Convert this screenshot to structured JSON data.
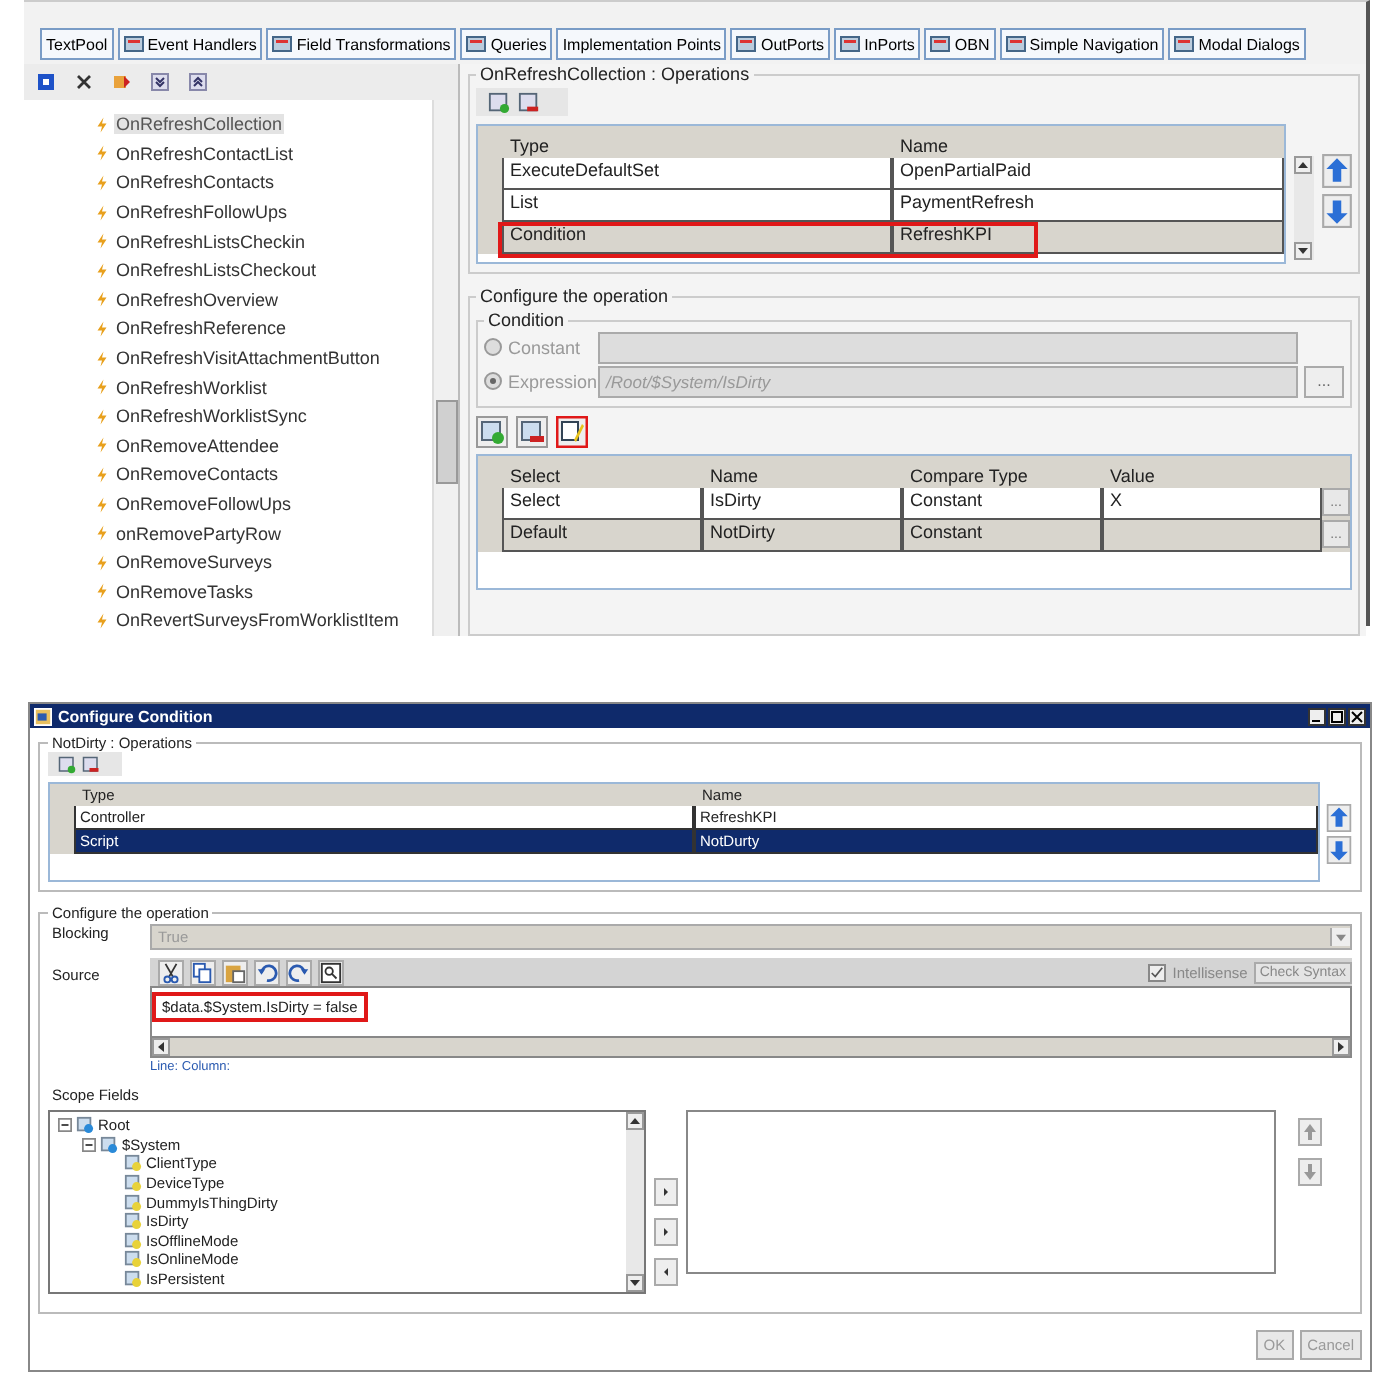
{
  "tabs": [
    {
      "label": "TextPool",
      "has_icon": false
    },
    {
      "label": "Event Handlers",
      "has_icon": true
    },
    {
      "label": "Field Transformations",
      "has_icon": true
    },
    {
      "label": "Queries",
      "has_icon": true
    },
    {
      "label": "Implementation Points",
      "has_icon": false
    },
    {
      "label": "OutPorts",
      "has_icon": true
    },
    {
      "label": "InPorts",
      "has_icon": true
    },
    {
      "label": "OBN",
      "has_icon": true
    },
    {
      "label": "Simple Navigation",
      "has_icon": true
    },
    {
      "label": "Modal Dialogs",
      "has_icon": true
    }
  ],
  "events": [
    {
      "label": "OnRefreshCollection",
      "selected": true
    },
    {
      "label": "OnRefreshContactList",
      "selected": false
    },
    {
      "label": "OnRefreshContacts",
      "selected": false
    },
    {
      "label": "OnRefreshFollowUps",
      "selected": false
    },
    {
      "label": "OnRefreshListsCheckin",
      "selected": false
    },
    {
      "label": "OnRefreshListsCheckout",
      "selected": false
    },
    {
      "label": "OnRefreshOverview",
      "selected": false
    },
    {
      "label": "OnRefreshReference",
      "selected": false
    },
    {
      "label": "OnRefreshVisitAttachmentButton",
      "selected": false
    },
    {
      "label": "OnRefreshWorklist",
      "selected": false
    },
    {
      "label": "OnRefreshWorklistSync",
      "selected": false
    },
    {
      "label": "OnRemoveAttendee",
      "selected": false
    },
    {
      "label": "OnRemoveContacts",
      "selected": false
    },
    {
      "label": "OnRemoveFollowUps",
      "selected": false
    },
    {
      "label": "onRemovePartyRow",
      "selected": false
    },
    {
      "label": "OnRemoveSurveys",
      "selected": false
    },
    {
      "label": "OnRemoveTasks",
      "selected": false
    },
    {
      "label": "OnRevertSurveysFromWorklistItem",
      "selected": false
    }
  ],
  "operations": {
    "title": "OnRefreshCollection : Operations",
    "columns": [
      "Type",
      "Name"
    ],
    "rows": [
      {
        "cells": [
          "ExecuteDefaultSet",
          "OpenPartialPaid"
        ],
        "selected": false,
        "highlighted": false
      },
      {
        "cells": [
          "List",
          "PaymentRefresh"
        ],
        "selected": false,
        "highlighted": false
      },
      {
        "cells": [
          "Condition",
          "RefreshKPI"
        ],
        "selected": true,
        "highlighted": true
      }
    ]
  },
  "configure": {
    "title": "Configure the operation",
    "condition_title": "Condition",
    "options": [
      {
        "label": "Constant",
        "selected": false
      },
      {
        "label": "Expression",
        "selected": true,
        "value": "/Root/$System/IsDirty"
      }
    ],
    "browse": "...",
    "edit_highlighted": true
  },
  "conditions": {
    "columns": [
      "Select",
      "Name",
      "Compare Type",
      "Value"
    ],
    "rows": [
      {
        "cells": [
          "Select",
          "IsDirty",
          "Constant",
          "X"
        ],
        "selected": false,
        "button": "..."
      },
      {
        "cells": [
          "Default",
          "NotDirty",
          "Constant",
          ""
        ],
        "selected": true,
        "button": "..."
      }
    ]
  },
  "dialog": {
    "title": "Configure Condition",
    "operations_title": "NotDirty : Operations",
    "columns": [
      "Type",
      "Name"
    ],
    "rows": [
      {
        "cells": [
          "Controller",
          "RefreshKPI"
        ],
        "selected": false
      },
      {
        "cells": [
          "Script",
          "NotDurty"
        ],
        "selected": true
      }
    ],
    "configure_title": "Configure the operation",
    "blocking_label": "Blocking",
    "blocking_value": "True",
    "source_label": "Source",
    "intellisense": {
      "label": "Intellisense",
      "checked": true
    },
    "check_syntax": "Check Syntax",
    "code": "$data.$System.IsDirty = false",
    "code_highlighted": true,
    "status": "Line:  Column:",
    "scope_label": "Scope Fields",
    "tree": [
      {
        "label": "Root",
        "expanded": true,
        "children": [
          {
            "label": "$System",
            "expanded": true,
            "children": [
              {
                "label": "ClientType"
              },
              {
                "label": "DeviceType"
              },
              {
                "label": "DummyIsThingDirty"
              },
              {
                "label": "IsDirty"
              },
              {
                "label": "IsOfflineMode"
              },
              {
                "label": "IsOnlineMode"
              },
              {
                "label": "IsPersistent"
              }
            ]
          }
        ]
      }
    ],
    "ok": "OK",
    "cancel": "Cancel"
  }
}
